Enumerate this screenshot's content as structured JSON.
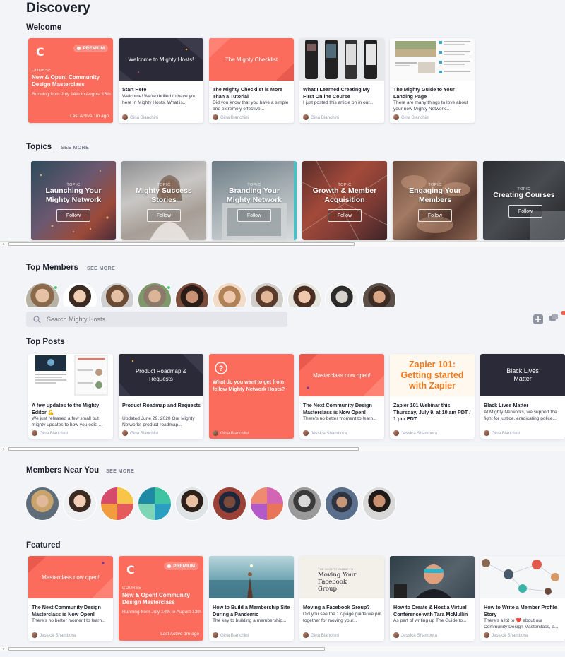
{
  "page": {
    "title": "Discovery"
  },
  "colors": {
    "coral": "#fb6c5d",
    "dark": "#2b2a38",
    "background": "#f3f4f8"
  },
  "sections": {
    "welcome": "Welcome",
    "topics": "Topics",
    "top_members": "Top Members",
    "top_posts": "Top Posts",
    "members_near": "Members Near You",
    "featured": "Featured",
    "see_more": "SEE MORE"
  },
  "search": {
    "placeholder": "Search Mighty Hosts"
  },
  "welcome": {
    "course": {
      "logo": "C",
      "badge": "PREMIUM",
      "label": "COURSE",
      "title": "New & Open! Community Design Masterclass",
      "running": "Running from July 14th to August 13th",
      "active": "Last Active 1m ago"
    },
    "cards": [
      {
        "thumb": "Welcome to Mighty Hosts!",
        "title": "Start Here",
        "body": "Welcome! We're thrilled to have you here in Mighty Hosts.  What is...",
        "author": "Gina Bianchini"
      },
      {
        "thumb": "The Mighty Checklist",
        "title": "The Mighty Checklist is More Than a Tutorial",
        "body": "Did you know that you have a simple and extremely effective...",
        "author": "Gina Bianchini"
      },
      {
        "thumb": "",
        "title": "What I Learned Creating My First Online Course",
        "body": "I just posted this article on in our...",
        "author": "Gina Bianchini"
      },
      {
        "thumb": "",
        "title": "The Mighty Guide to Your Landing Page",
        "body": "There are many things to love about your new Mighty Network...",
        "author": "Gina Bianchini"
      }
    ]
  },
  "topics": [
    {
      "label": "TOPIC",
      "name": "Launching Your Mighty Network",
      "follow": "Follow"
    },
    {
      "label": "TOPIC",
      "name": "Mighty Success Stories",
      "follow": "Follow"
    },
    {
      "label": "TOPIC",
      "name": "Branding Your Mighty Network",
      "follow": "Follow"
    },
    {
      "label": "TOPIC",
      "name": "Growth & Member Acquisition",
      "follow": "Follow"
    },
    {
      "label": "TOPIC",
      "name": "Engaging Your Members",
      "follow": "Follow"
    },
    {
      "label": "TOPIC",
      "name": "Creating Courses",
      "follow": "Follow"
    }
  ],
  "top_posts": [
    {
      "thumb": "",
      "title": "A few updates to the Mighty Editor 💪",
      "body": "We just released a few small but mighty updates to how you edit: ...",
      "author": "Gina Bianchini"
    },
    {
      "thumb": "Product Roadmap & Requests",
      "title": "Product Roadmap and Requests",
      "body": "Updated June 29, 2020 Our Mighty Networks product roadmap...",
      "author": "Gina Bianchini"
    },
    {
      "thumb": "What do you want to get from fellow Mighty Network Hosts?",
      "title": "",
      "body": "",
      "author": "Gina Bianchini"
    },
    {
      "thumb": "Masterclass now open!",
      "title": "The Next Community Design Masterclass is Now Open!",
      "body": "There's no better moment to learn...",
      "author": "Jessica Shambora"
    },
    {
      "thumb": "Zapier 101: Getting started with Zapier",
      "title": "Zapier 101 Webinar this Thursday, July 9, at 10 am PDT / 1 pm EDT",
      "body": "",
      "author": "Jessica Shambora"
    },
    {
      "thumb": "Black Lives Matter",
      "title": "Black Lives Matter",
      "body": "At Mighty Networks, we support the fight for justice, eradicating police...",
      "author": "Gina Bianchini"
    }
  ],
  "featured": {
    "cards": [
      {
        "thumb": "Masterclass now open!",
        "title": "The Next Community Design Masterclass is Now Open!",
        "body": "There's no better moment to learn...",
        "author": "Jessica Shambora"
      },
      {
        "thumb": "",
        "title": "How to Build a Membership Site During a Pandemic",
        "body": "The key to building a membership...",
        "author": "Gina Bianchini"
      },
      {
        "thumb": "Moving Your Facebook Group",
        "title": "Moving a Facebook Group?",
        "body": "Did you see the 17-page guide we put together for moving your...",
        "author": "Gina Bianchini"
      },
      {
        "thumb": "",
        "title": "How to Create & Host a Virtual Conference with Tara McMullin",
        "body": "As part of writing up The Guide to...",
        "author": "Jessica Shambora"
      },
      {
        "thumb": "",
        "title": "How to Write a Member Profile Story",
        "body": "There's a lot to ❤️ about our Community Design Masterclass, a...",
        "author": "Jessica Shambora"
      }
    ],
    "thumb_small": "THE MIGHTY GUIDE TO"
  }
}
